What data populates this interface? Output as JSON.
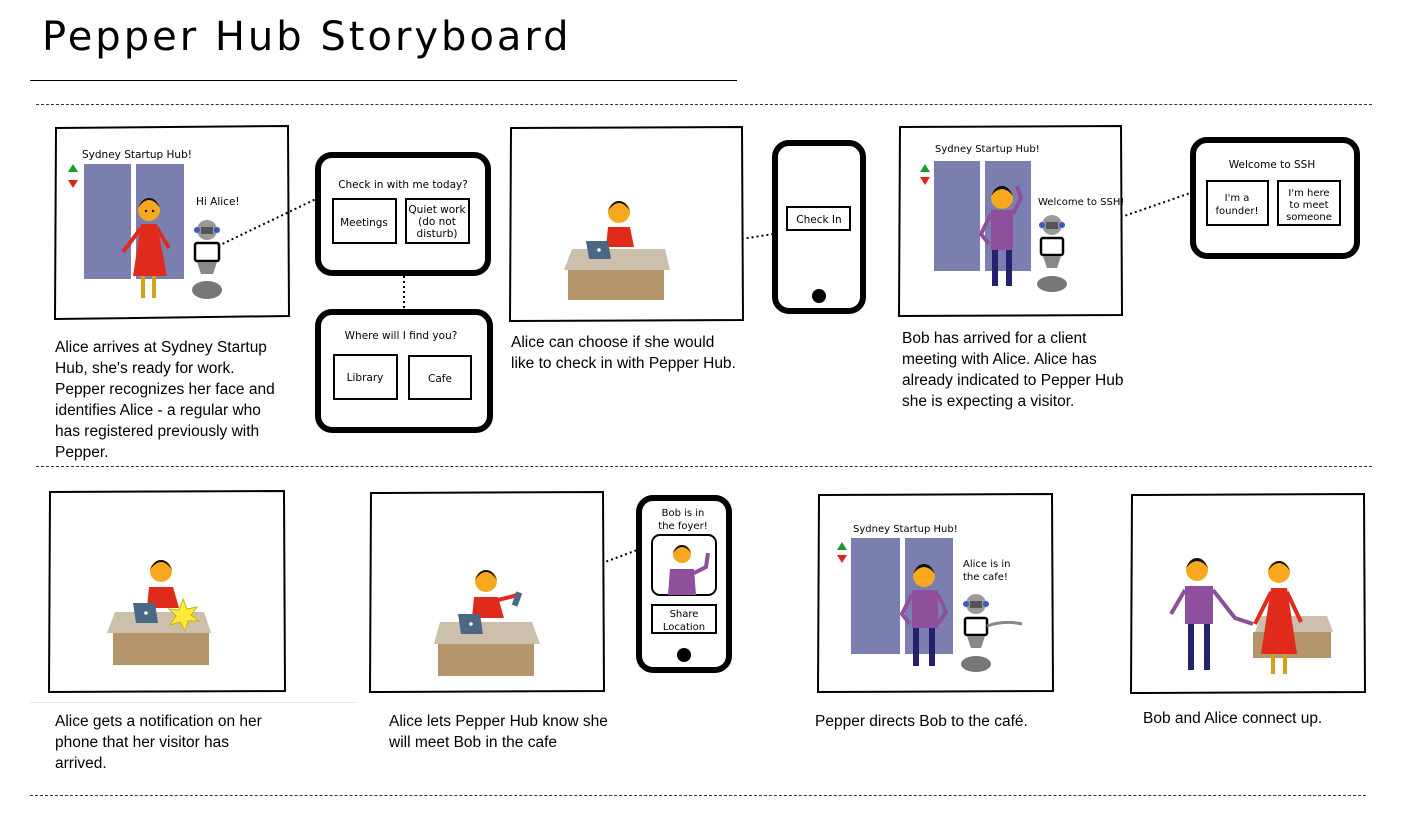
{
  "title": "Pepper Hub Storyboard",
  "colors": {
    "door": "#7b7fb0",
    "desk": "#b5966c",
    "desk_top": "#ccc0ac",
    "alice_dress": "#e02a1c",
    "bob_shirt": "#8e4f9c",
    "bob_pants": "#24226f",
    "skin": "#f7a81f",
    "laptop": "#4a6885"
  },
  "panel1": {
    "sign": "Sydney Startup Hub!",
    "greeting": "Hi Alice!",
    "caption": "Alice arrives at Sydney Startup Hub, she's ready for work. Pepper recognizes her face and identifies Alice - a regular who has registered previously with Pepper."
  },
  "tablet1": {
    "prompt": "Check in with me today?",
    "option_meetings": "Meetings",
    "option_quiet_1": "Quiet work",
    "option_quiet_2": "(do not",
    "option_quiet_3": "disturb)"
  },
  "tablet2": {
    "prompt": "Where will I find you?",
    "option_library": "Library",
    "option_cafe": "Cafe"
  },
  "panel2": {
    "caption": "Alice can choose if she would like to check in with Pepper Hub."
  },
  "phone1": {
    "button": "Check In"
  },
  "panel3": {
    "sign": "Sydney Startup Hub!",
    "greeting": "Welcome to SSH!",
    "caption": "Bob has arrived for a client meeting with Alice. Alice has already indicated to Pepper Hub she is expecting a visitor."
  },
  "tablet3": {
    "prompt": "Welcome to SSH",
    "option_founder_1": "I'm a",
    "option_founder_2": "founder!",
    "option_meet_1": "I'm here",
    "option_meet_2": "to meet",
    "option_meet_3": "someone"
  },
  "panel4": {
    "caption": "Alice gets a notification on her phone that her visitor has arrived."
  },
  "panel5": {
    "caption": "Alice lets Pepper Hub know she will meet Bob in the cafe"
  },
  "phone2": {
    "message_1": "Bob is in",
    "message_2": "the foyer!",
    "button_1": "Share",
    "button_2": "Location"
  },
  "panel6": {
    "sign": "Sydney Startup Hub!",
    "bubble_1": "Alice is in",
    "bubble_2": "the cafe!",
    "caption": "Pepper directs Bob to the café."
  },
  "panel7": {
    "caption": "Bob and Alice connect up."
  }
}
